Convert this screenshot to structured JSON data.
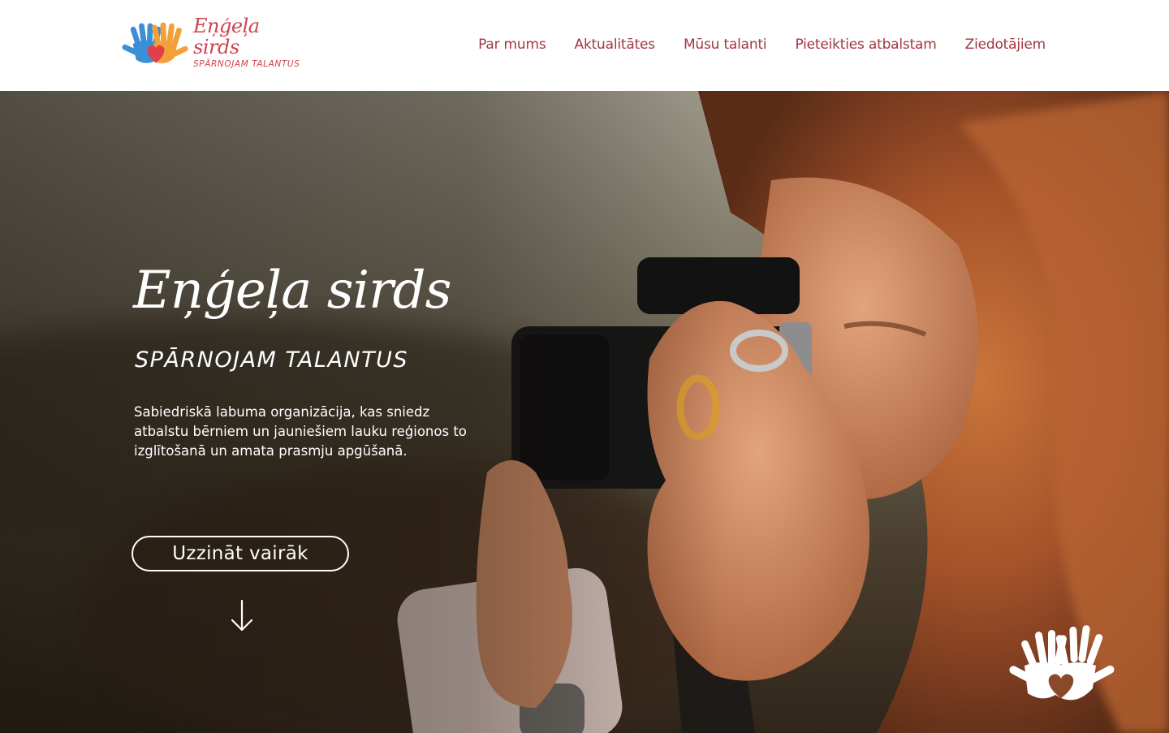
{
  "header": {
    "logo": {
      "title": "Eņģeļa sirds",
      "subtitle": "SPĀRNOJAM TALANTUS",
      "icon": "hands-heart-icon",
      "colors": {
        "blue": "#3a8fd6",
        "orange": "#f2a037",
        "heart": "#e0404c",
        "text": "#d2424c"
      }
    },
    "nav": [
      {
        "label": "Par mums"
      },
      {
        "label": "Aktualitātes"
      },
      {
        "label": "Mūsu talanti"
      },
      {
        "label": "Pieteikties atbalstam"
      },
      {
        "label": "Ziedotājiem"
      }
    ],
    "nav_color": "#a23641"
  },
  "hero": {
    "title": "Eņģeļa sirds",
    "subtitle": "SPĀRNOJAM TALANTUS",
    "description": "Sabiedriskā labuma organizācija, kas sniedz atbalstu bērniem un jauniešiem lauku reģionos to izglītošanā un amata prasmju apgūšanā.",
    "button_label": "Uzzināt vairāk",
    "scroll_icon": "arrow-down-icon",
    "badge_icon": "hands-heart-icon",
    "image": "woman-with-camera-photo"
  }
}
